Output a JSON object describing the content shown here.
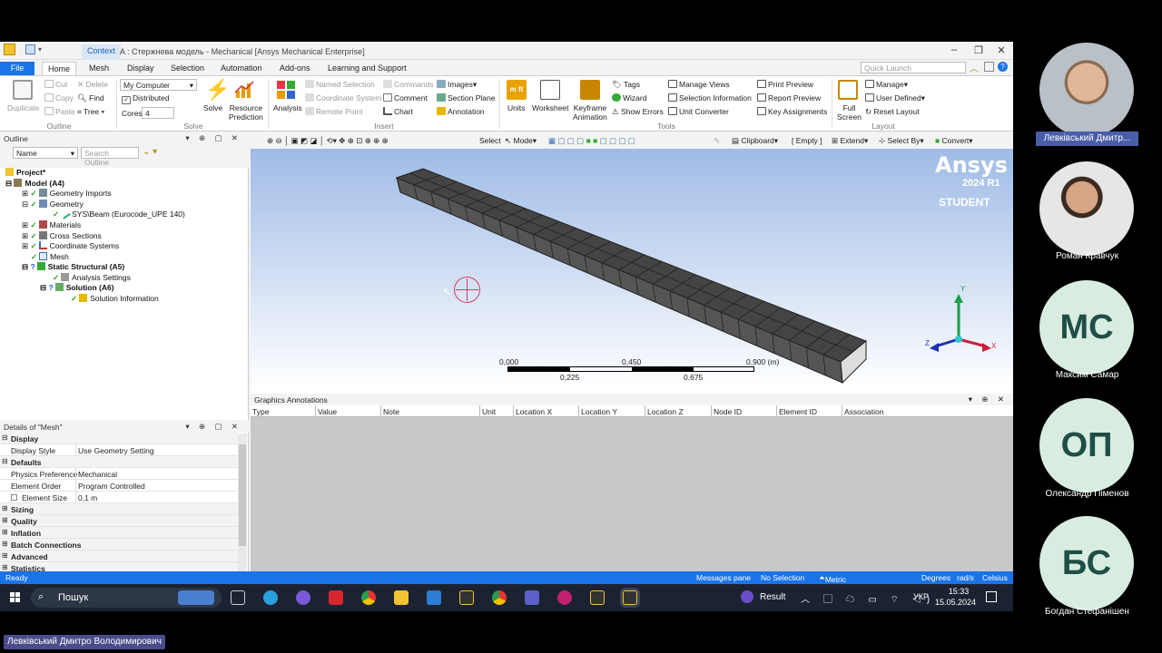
{
  "window": {
    "context_tab": "Context",
    "title": "A : Стержнева модель - Mechanical [Ansys Mechanical Enterprise]"
  },
  "tabs": [
    "File",
    "Home",
    "Mesh",
    "Display",
    "Selection",
    "Automation",
    "Add-ons",
    "Learning and Support"
  ],
  "quick_launch": {
    "placeholder": "Quick Launch"
  },
  "ribbon": {
    "outline": {
      "duplicate": "Duplicate",
      "cut": "Cut",
      "copy": "Copy",
      "paste": "Paste",
      "delete": "Delete",
      "find": "Find",
      "tree": "Tree",
      "group": "Outline"
    },
    "solve": {
      "machine": "My Computer",
      "distributed": "Distributed",
      "cores_label": "Cores",
      "cores": "4",
      "solve": "Solve",
      "resource": "Resource",
      "prediction": "Prediction",
      "group": "Solve"
    },
    "insert": {
      "analysis": "Analysis",
      "named_selection": "Named Selection",
      "coordinate_system": "Coordinate System",
      "remote_point": "Remote Point",
      "commands": "Commands",
      "comment": "Comment",
      "chart": "Chart",
      "images": "Images",
      "section_plane": "Section Plane",
      "annotation": "Annotation",
      "group": "Insert"
    },
    "tools": {
      "units": "Units",
      "worksheet": "Worksheet",
      "keyframe": "Keyframe",
      "animation": "Animation",
      "tags": "Tags",
      "wizard": "Wizard",
      "show_errors": "Show Errors",
      "manage_views": "Manage Views",
      "selection_information": "Selection Information",
      "unit_converter": "Unit Converter",
      "print_preview": "Print Preview",
      "report_preview": "Report Preview",
      "key_assignments": "Key Assignments",
      "group": "Tools"
    },
    "layout": {
      "full": "Full",
      "screen": "Screen",
      "manage": "Manage",
      "user_defined": "User Defined",
      "reset_layout": "Reset Layout",
      "group": "Layout"
    }
  },
  "outline": {
    "title": "Outline",
    "filter": "Name",
    "search_placeholder": "Search Outline",
    "nodes": [
      "Project*",
      "Model (A4)",
      "Geometry Imports",
      "Geometry",
      "SYS\\Beam (Eurocode_UPE 140)",
      "Materials",
      "Cross Sections",
      "Coordinate Systems",
      "Mesh",
      "Static Structural (A5)",
      "Analysis Settings",
      "Solution (A6)",
      "Solution Information"
    ]
  },
  "details": {
    "title": "Details of \"Mesh\"",
    "rows": [
      {
        "k": "Display",
        "v": "",
        "sec": true
      },
      {
        "k": "Display Style",
        "v": "Use Geometry Setting"
      },
      {
        "k": "Defaults",
        "v": "",
        "sec": true
      },
      {
        "k": "Physics Preference",
        "v": "Mechanical"
      },
      {
        "k": "Element Order",
        "v": "Program Controlled"
      },
      {
        "k": "Element Size",
        "v": "0,1 m"
      },
      {
        "k": "Sizing",
        "v": "",
        "sec": true
      },
      {
        "k": "Quality",
        "v": "",
        "sec": true
      },
      {
        "k": "Inflation",
        "v": "",
        "sec": true
      },
      {
        "k": "Batch Connections",
        "v": "",
        "sec": true
      },
      {
        "k": "Advanced",
        "v": "",
        "sec": true
      },
      {
        "k": "Statistics",
        "v": "",
        "sec": true
      }
    ]
  },
  "graphics_toolbar": {
    "select": "Select",
    "mode": "Mode",
    "clipboard": "Clipboard",
    "empty": "[ Empty ]",
    "extend": "Extend",
    "select_by": "Select By",
    "convert": "Convert"
  },
  "viewport": {
    "brand": "Ansys",
    "version": "2024 R1",
    "edition": "STUDENT",
    "scale_top": [
      "0,000",
      "0,450",
      "0,900 (m)"
    ],
    "scale_bottom": [
      "0,225",
      "0,675"
    ],
    "axes": [
      "Y",
      "X",
      "Z"
    ]
  },
  "annotations": {
    "title": "Graphics Annotations",
    "columns": [
      "Type",
      "Value",
      "Note",
      "Unit",
      "Location X",
      "Location Y",
      "Location Z",
      "Node ID",
      "Element ID",
      "Association"
    ]
  },
  "status": {
    "ready": "Ready",
    "messages": "Messages pane",
    "selection": "No Selection",
    "units": "Metric (m, kg, N, s, V, A)",
    "angle": "Degrees",
    "rate": "rad/s",
    "temp": "Celsius"
  },
  "taskbar": {
    "search": "Пошук",
    "result": "Result",
    "lang": "УКР",
    "time": "15:33",
    "date": "15.05.2024"
  },
  "participants": [
    {
      "name": "Левківський Дмитр...",
      "type": "photo"
    },
    {
      "name": "Роман Кравчук",
      "type": "photo"
    },
    {
      "name": "Максим Самар",
      "initials": "МС"
    },
    {
      "name": "Олександр Піменов",
      "initials": "ОП"
    },
    {
      "name": "Богдан Стефанішен",
      "initials": "БС"
    }
  ],
  "speaker_caption": "Левківський Дмитро Володимирович",
  "colors": {
    "accent": "#1a73e8",
    "initials_bg": "#d8ece0",
    "initials_fg": "#1f4e47"
  }
}
